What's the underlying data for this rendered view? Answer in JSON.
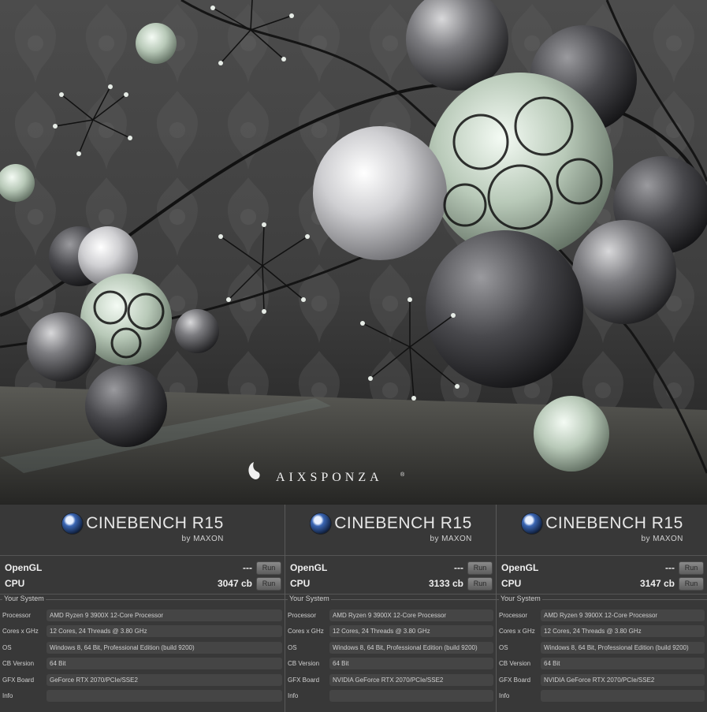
{
  "render": {
    "watermark": "AIXSPONZA",
    "watermark_mark": "®"
  },
  "panels": [
    {
      "brand": "CINEBENCH R15",
      "byline": "by MAXON",
      "opengl": {
        "label": "OpenGL",
        "value": "---",
        "run": "Run"
      },
      "cpu": {
        "label": "CPU",
        "value": "3047 cb",
        "run": "Run"
      },
      "system_title": "Your System",
      "system": [
        {
          "key": "Processor",
          "value": "AMD Ryzen 9 3900X 12-Core Processor"
        },
        {
          "key": "Cores x GHz",
          "value": "12 Cores, 24 Threads @ 3.80 GHz"
        },
        {
          "key": "OS",
          "value": "Windows 8, 64 Bit, Professional Edition (build 9200)"
        },
        {
          "key": "CB Version",
          "value": "64 Bit"
        },
        {
          "key": "GFX Board",
          "value": "GeForce RTX 2070/PCIe/SSE2"
        },
        {
          "key": "Info",
          "value": ""
        }
      ]
    },
    {
      "brand": "CINEBENCH R15",
      "byline": "by MAXON",
      "opengl": {
        "label": "OpenGL",
        "value": "---",
        "run": "Run"
      },
      "cpu": {
        "label": "CPU",
        "value": "3133 cb",
        "run": "Run"
      },
      "system_title": "Your System",
      "system": [
        {
          "key": "Processor",
          "value": "AMD Ryzen 9 3900X 12-Core Processor"
        },
        {
          "key": "Cores x GHz",
          "value": "12 Cores, 24 Threads @ 3.80 GHz"
        },
        {
          "key": "OS",
          "value": "Windows 8, 64 Bit, Professional Edition (build 9200)"
        },
        {
          "key": "CB Version",
          "value": "64 Bit"
        },
        {
          "key": "GFX Board",
          "value": "NVIDIA GeForce RTX 2070/PCIe/SSE2"
        },
        {
          "key": "Info",
          "value": ""
        }
      ]
    },
    {
      "brand": "CINEBENCH R15",
      "byline": "by MAXON",
      "opengl": {
        "label": "OpenGL",
        "value": "---",
        "run": "Run"
      },
      "cpu": {
        "label": "CPU",
        "value": "3147 cb",
        "run": "Run"
      },
      "system_title": "Your System",
      "system": [
        {
          "key": "Processor",
          "value": "AMD Ryzen 9 3900X 12-Core Processor"
        },
        {
          "key": "Cores x GHz",
          "value": "12 Cores, 24 Threads @ 3.80 GHz"
        },
        {
          "key": "OS",
          "value": "Windows 8, 64 Bit, Professional Edition (build 9200)"
        },
        {
          "key": "CB Version",
          "value": "64 Bit"
        },
        {
          "key": "GFX Board",
          "value": "NVIDIA GeForce RTX 2070/PCIe/SSE2"
        },
        {
          "key": "Info",
          "value": ""
        }
      ]
    }
  ]
}
